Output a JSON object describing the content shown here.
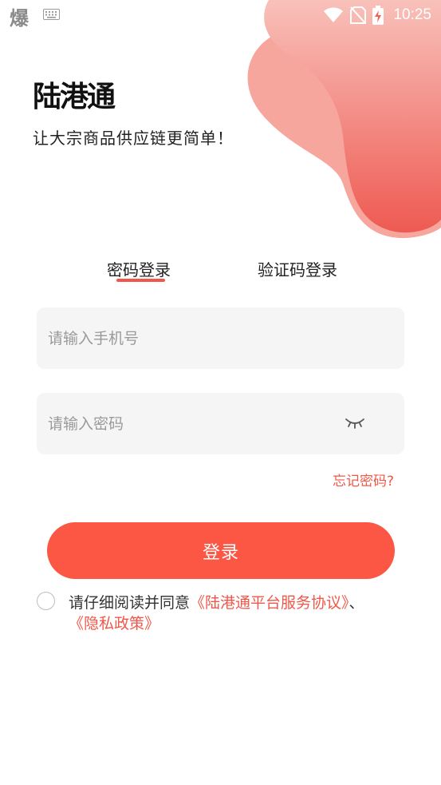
{
  "status_bar": {
    "left_glyph": "爆",
    "time": "10:25",
    "icons": [
      "keyboard-icon",
      "wifi-icon",
      "no-sim-icon",
      "battery-charging-icon"
    ]
  },
  "brand": {
    "logo_text": "陆港通",
    "slogan": "让大宗商品供应链更简单！"
  },
  "tabs": [
    {
      "label": "密码登录",
      "active": true
    },
    {
      "label": "验证码登录",
      "active": false
    }
  ],
  "form": {
    "phone_placeholder": "请输入手机号",
    "phone_value": "",
    "password_placeholder": "请输入密码",
    "password_value": "",
    "forgot_label": "忘记密码?",
    "login_label": "登录"
  },
  "agreement": {
    "checked": false,
    "prefix": "请仔细阅读并同意",
    "service_link": "《陆港通平台服务协议》",
    "separator": "、",
    "privacy_link": "《隐私政策》"
  },
  "colors": {
    "accent": "#fb5744",
    "link": "#f0574a",
    "blob_light": "#f6a69d",
    "blob_dark": "#ee5f57",
    "field_bg": "#f5f5f5"
  }
}
